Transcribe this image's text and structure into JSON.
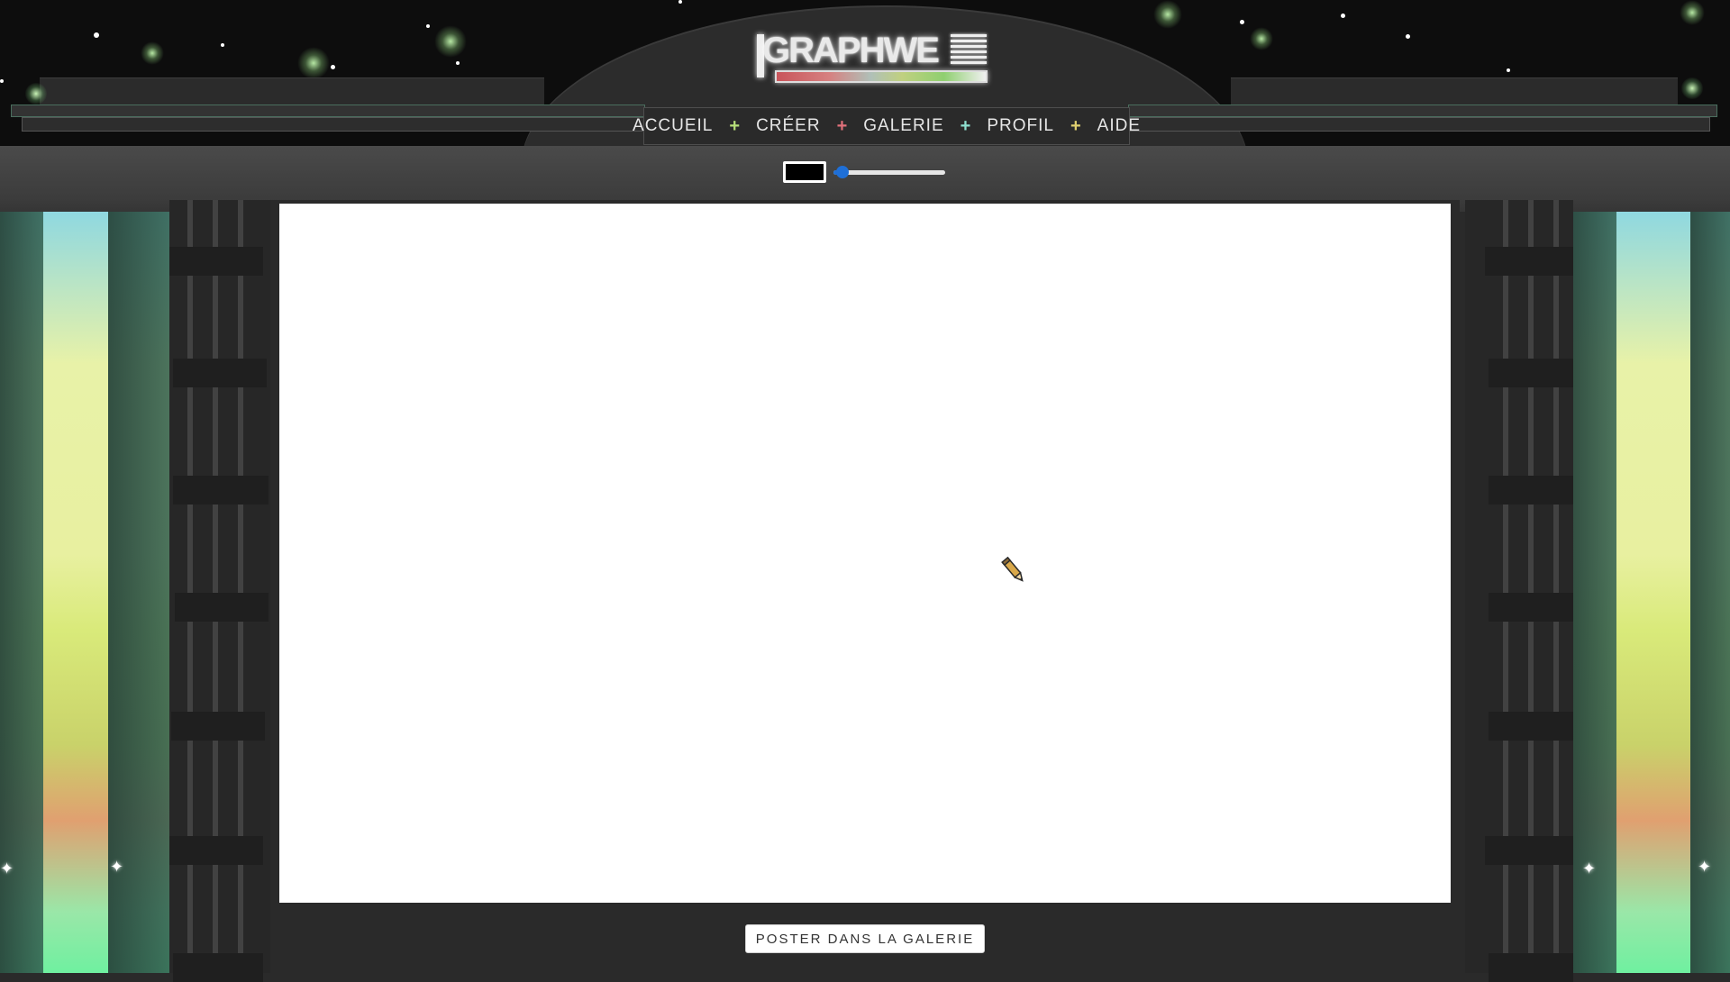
{
  "app": {
    "logo_text": "GRAPHWE"
  },
  "nav": {
    "items": [
      {
        "label": "ACCUEIL"
      },
      {
        "label": "CRÉER"
      },
      {
        "label": "GALERIE"
      },
      {
        "label": "PROFIL"
      },
      {
        "label": "AIDE"
      }
    ],
    "separator": "+",
    "separator_colors": [
      "#b8e07a",
      "#e0707a",
      "#8fe0d0",
      "#e0d070"
    ]
  },
  "toolbar": {
    "brush_color": "#000000",
    "brush_size_fraction": 0.08,
    "slider_accent": "#1f6fd6"
  },
  "canvas": {
    "background": "#ffffff",
    "cursor_icon": "pencil-icon"
  },
  "actions": {
    "post_label": "POSTER DANS LA GALERIE"
  },
  "icons": {
    "sparkle": "✦"
  }
}
